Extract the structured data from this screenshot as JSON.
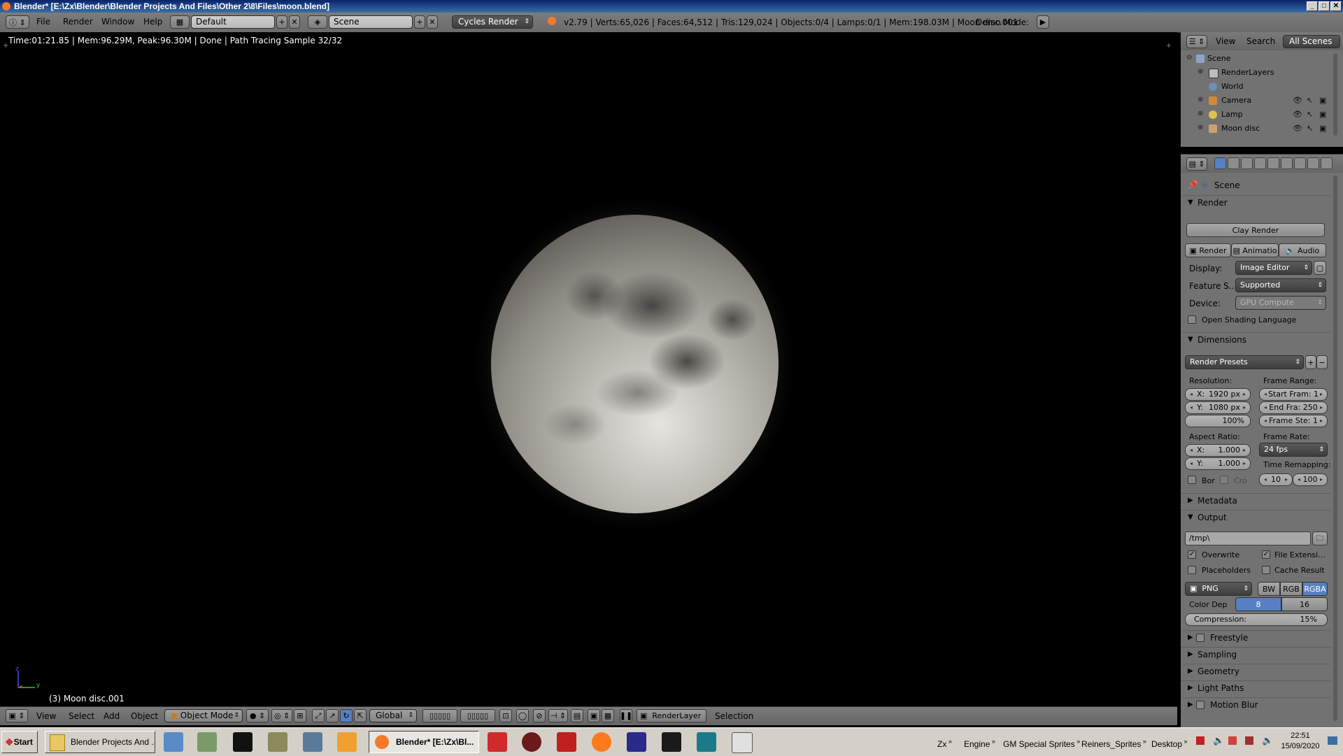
{
  "window": {
    "title": "Blender* [E:\\Zx\\Blender\\Blender Projects And Files\\Other 2\\8\\Files\\moon.blend]",
    "min": "_",
    "max": "□",
    "close": "✕"
  },
  "info_header": {
    "menus": [
      "File",
      "Render",
      "Window",
      "Help"
    ],
    "layout": "Default",
    "scene": "Scene",
    "engine": "Cycles Render",
    "stats": "v2.79 | Verts:65,026 | Faces:64,512 | Tris:129,024 | Objects:0/4 | Lamps:0/1 | Mem:198.03M | Moon disc.001",
    "demo_mode": "Demo Mode:"
  },
  "viewport": {
    "render_status": "Time:01:21.85 | Mem:96.29M, Peak:96.30M | Done | Path Tracing Sample 32/32",
    "object_label": "(3) Moon disc.001",
    "axis_x": "x",
    "axis_y": "y",
    "axis_z": "z"
  },
  "view_header": {
    "menus": [
      "View",
      "Select",
      "Add",
      "Object"
    ],
    "mode": "Object Mode",
    "orientation": "Global",
    "render_layer": "RenderLayer",
    "selection": "Selection"
  },
  "outliner_header": {
    "view": "View",
    "search": "Search",
    "filter": "All Scenes"
  },
  "outliner": {
    "items": [
      {
        "label": "Scene"
      },
      {
        "label": "RenderLayers"
      },
      {
        "label": "World"
      },
      {
        "label": "Camera"
      },
      {
        "label": "Lamp"
      },
      {
        "label": "Moon disc"
      }
    ]
  },
  "properties": {
    "context": "Scene",
    "render_section": "Render",
    "clay_render": "Clay Render",
    "tabs": [
      "Render",
      "Animatio",
      "Audio"
    ],
    "display_label": "Display:",
    "display_value": "Image Editor",
    "feature_label": "Feature S...",
    "feature_value": "Supported",
    "device_label": "Device:",
    "device_value": "GPU Compute",
    "osl_label": "Open Shading Language",
    "dimensions_section": "Dimensions",
    "render_presets": "Render Presets",
    "resolution_label": "Resolution:",
    "res_x_key": "X:",
    "res_x": "1920 px",
    "res_y_key": "Y:",
    "res_y": "1080 px",
    "res_pct": "100%",
    "frame_range_label": "Frame Range:",
    "start_frame": "Start Fram: 1",
    "end_frame": "End Fra: 250",
    "frame_step": "Frame Ste: 1",
    "aspect_label": "Aspect Ratio:",
    "aspect_x_key": "X:",
    "aspect_x": "1.000",
    "aspect_y_key": "Y:",
    "aspect_y": "1.000",
    "frame_rate_label": "Frame Rate:",
    "frame_rate": "24 fps",
    "time_remap_label": "Time Remapping:",
    "remap_old": "10",
    "remap_new": "100",
    "border_label": "Bor",
    "crop_label": "Cro",
    "metadata_section": "Metadata",
    "output_section": "Output",
    "output_path": "/tmp\\",
    "overwrite": "Overwrite",
    "file_ext": "File Extensi...",
    "placeholders": "Placeholders",
    "cache_result": "Cache Result",
    "format": "PNG",
    "color_modes": [
      "BW",
      "RGB",
      "RGBA"
    ],
    "color_depth_label": "Color Dep",
    "depth_options": [
      "8",
      "16"
    ],
    "compression_label": "Compression:",
    "compression_value": "15%",
    "collapsed_sections": [
      "Freestyle",
      "Sampling",
      "Geometry",
      "Light Paths",
      "Motion Blur"
    ]
  },
  "taskbar": {
    "start": "Start",
    "buttons": [
      "Blender Projects And ...",
      "Blender* [E:\\Zx\\Bl..."
    ],
    "tray_labels": [
      "Zx",
      "Engine",
      "GM Special Sprites",
      "Reiners_Sprites",
      "Desktop"
    ],
    "time": "22:51",
    "date": "15/09/2020"
  },
  "colors": {
    "accent_blue": "#5680c2",
    "blender_header": "#727272",
    "titlebar": "#0a246a",
    "taskbar": "#d4d0c8"
  }
}
